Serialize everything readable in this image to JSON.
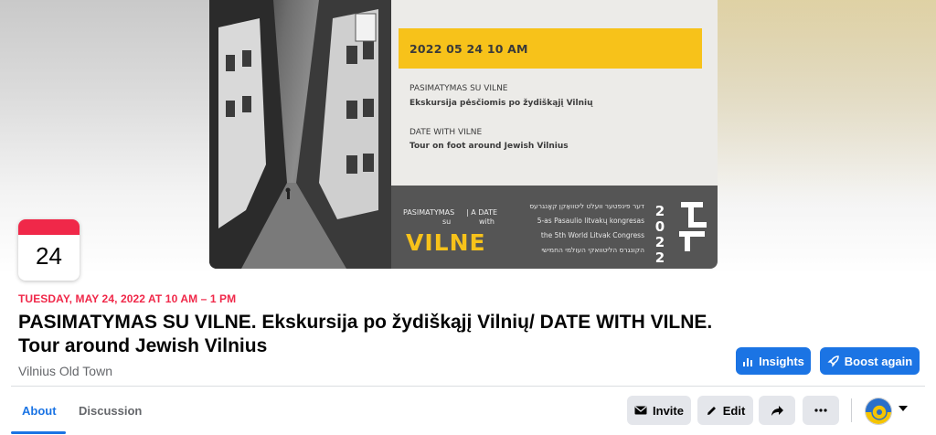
{
  "cover": {
    "date_time": "2022 05 24   10 AM",
    "lt_heading": "PASIMATYMAS SU VILNE",
    "lt_subheading": "Ekskursija pėsčiomis po žydiškąjį Vilnių",
    "en_heading": "DATE WITH VILNE",
    "en_subheading": "Tour on foot around Jewish Vilnius",
    "left_label_1": "PASIMATYMAS",
    "left_label_2": "su",
    "right_label_1": "| A DATE",
    "right_label_2": "with",
    "logo_word": "VILNE",
    "congress_yiddish": "דער פינפטער וועלט ליטוואַקן קאָנגרעס",
    "congress_lt": "5-as Pasaulio litvakų kongresas",
    "congress_en": "the 5th World Litvak Congress",
    "congress_hebrew": "הקונגרס הליטוואקי העולמי החמישי",
    "year_digits": [
      "2",
      "0",
      "2",
      "2"
    ],
    "brand_colors": {
      "yellow": "#f7c21a",
      "gray": "#555555"
    }
  },
  "calendar": {
    "day": "24",
    "accent": "#f02849"
  },
  "event": {
    "when": "TUESDAY, MAY 24, 2022 AT 10 AM – 1 PM",
    "title": "PASIMATYMAS SU VILNE. Ekskursija po žydiškąjį Vilnių/ DATE WITH VILNE. Tour around Jewish Vilnius",
    "location": "Vilnius Old Town"
  },
  "actions": {
    "insights_label": "Insights",
    "boost_label": "Boost again",
    "invite_label": "Invite",
    "edit_label": "Edit",
    "share_icon": "share-arrow-icon",
    "more_icon": "more-dots-icon",
    "accent": "#1b74e4"
  },
  "tabs": [
    {
      "label": "About",
      "active": true
    },
    {
      "label": "Discussion",
      "active": false
    }
  ]
}
